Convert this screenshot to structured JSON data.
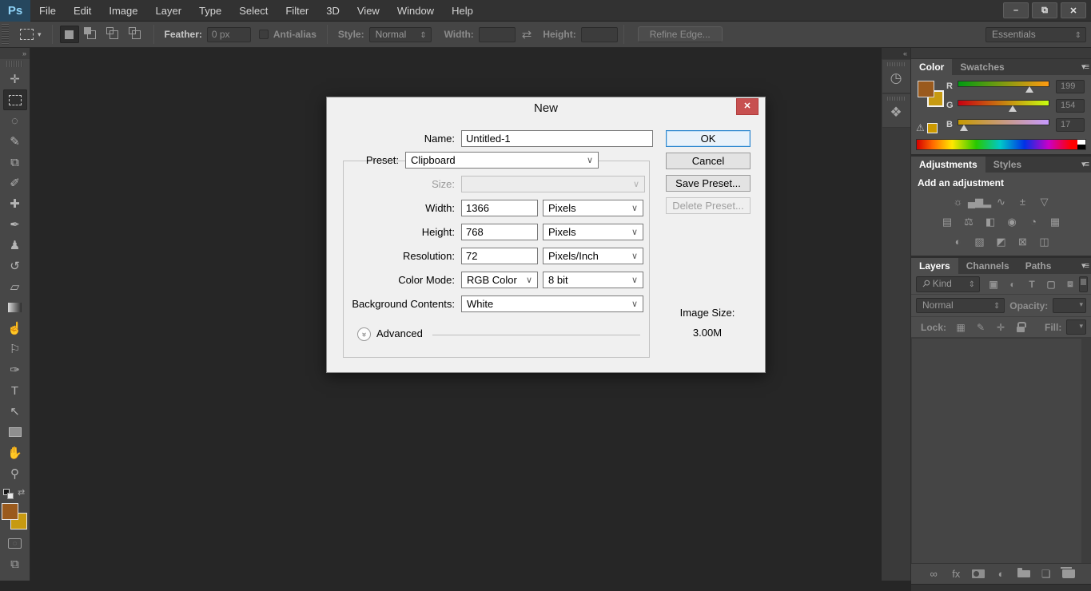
{
  "app": {
    "logo": "Ps"
  },
  "window_controls": {
    "minimize": "–",
    "restore": "⧉",
    "close": "✕"
  },
  "menu": {
    "items": [
      "File",
      "Edit",
      "Image",
      "Layer",
      "Type",
      "Select",
      "Filter",
      "3D",
      "View",
      "Window",
      "Help"
    ]
  },
  "options_bar": {
    "feather_label": "Feather:",
    "feather_value": "0 px",
    "anti_alias_label": "Anti-alias",
    "style_label": "Style:",
    "style_value": "Normal",
    "width_label": "Width:",
    "width_value": "",
    "height_label": "Height:",
    "height_value": "",
    "swap_icon": "⇄",
    "refine_edge_label": "Refine Edge...",
    "workspace": "Essentials"
  },
  "toolbar": {
    "collapse_chevron": "»",
    "foreground_color": "#9a5a1d",
    "background_color": "#c79a11",
    "tools": [
      {
        "name": "move-tool",
        "glyph": "✛"
      },
      {
        "name": "rectangular-marquee-tool",
        "glyph": "",
        "css": "icon-marquee",
        "selected": true
      },
      {
        "name": "lasso-tool",
        "glyph": "◌"
      },
      {
        "name": "quick-selection-tool",
        "glyph": "✎"
      },
      {
        "name": "crop-tool",
        "glyph": "⧉"
      },
      {
        "name": "eyedropper-tool",
        "glyph": "✐"
      },
      {
        "name": "spot-healing-brush-tool",
        "glyph": "✚"
      },
      {
        "name": "brush-tool",
        "glyph": "✒"
      },
      {
        "name": "clone-stamp-tool",
        "glyph": "♟"
      },
      {
        "name": "history-brush-tool",
        "glyph": "↺"
      },
      {
        "name": "eraser-tool",
        "glyph": "▱"
      },
      {
        "name": "gradient-tool",
        "glyph": "",
        "css": "icon-gradient"
      },
      {
        "name": "smudge-tool",
        "glyph": "☝"
      },
      {
        "name": "dodge-tool",
        "glyph": "⚐"
      },
      {
        "name": "pen-tool",
        "glyph": "✑"
      },
      {
        "name": "type-tool",
        "glyph": "T"
      },
      {
        "name": "path-selection-tool",
        "glyph": "↖"
      },
      {
        "name": "rectangle-tool",
        "glyph": "",
        "css": "icon-rectshape"
      },
      {
        "name": "hand-tool",
        "glyph": "✋"
      },
      {
        "name": "zoom-tool",
        "glyph": "⚲"
      }
    ]
  },
  "dock": {
    "collapse_chevron": "«",
    "panels": [
      {
        "name": "history-panel-button",
        "glyph": "◷"
      },
      {
        "name": "properties-panel-button",
        "glyph": "❖"
      }
    ]
  },
  "dialog": {
    "title": "New",
    "close_glyph": "✕",
    "name_label": "Name:",
    "name_value": "Untitled-1",
    "preset_label": "Preset:",
    "preset_value": "Clipboard",
    "size_label": "Size:",
    "width_label": "Width:",
    "width_value": "1366",
    "width_unit": "Pixels",
    "height_label": "Height:",
    "height_value": "768",
    "height_unit": "Pixels",
    "resolution_label": "Resolution:",
    "resolution_value": "72",
    "resolution_unit": "Pixels/Inch",
    "color_mode_label": "Color Mode:",
    "color_mode_value": "RGB Color",
    "color_depth_value": "8 bit",
    "background_label": "Background Contents:",
    "background_value": "White",
    "advanced_label": "Advanced",
    "advanced_chevron": "»",
    "image_size_label": "Image Size:",
    "image_size_value": "3.00M",
    "buttons": {
      "ok": "OK",
      "cancel": "Cancel",
      "save_preset": "Save Preset...",
      "delete_preset": "Delete Preset..."
    }
  },
  "panels": {
    "color": {
      "tabs": [
        "Color",
        "Swatches"
      ],
      "foreground_color": "#9a5a1d",
      "background_color": "#c79a11",
      "websafe_color": "#cc9900",
      "warning_glyph": "⚠",
      "r_label": "R",
      "r_value": "199",
      "g_label": "G",
      "g_value": "154",
      "b_label": "B",
      "b_value": "17"
    },
    "adjustments": {
      "tabs": [
        "Adjustments",
        "Styles"
      ],
      "heading": "Add an adjustment",
      "row1": [
        {
          "name": "brightness-contrast-icon",
          "glyph": "☼"
        },
        {
          "name": "levels-icon",
          "glyph": "▄▆▂"
        },
        {
          "name": "curves-icon",
          "glyph": "∿"
        },
        {
          "name": "exposure-icon",
          "glyph": "±"
        },
        {
          "name": "vibrance-icon",
          "glyph": "▽"
        }
      ],
      "row2": [
        {
          "name": "hue-saturation-icon",
          "glyph": "▤"
        },
        {
          "name": "color-balance-icon",
          "glyph": "⚖"
        },
        {
          "name": "black-white-icon",
          "glyph": "◧"
        },
        {
          "name": "photo-filter-icon",
          "glyph": "◉"
        },
        {
          "name": "channel-mixer-icon",
          "glyph": "◔"
        },
        {
          "name": "color-lookup-icon",
          "glyph": "▦"
        }
      ],
      "row3": [
        {
          "name": "invert-icon",
          "glyph": "◐"
        },
        {
          "name": "posterize-icon",
          "glyph": "▨"
        },
        {
          "name": "threshold-icon",
          "glyph": "◩"
        },
        {
          "name": "gradient-map-icon",
          "glyph": "⊠"
        },
        {
          "name": "selective-color-icon",
          "glyph": "◫"
        }
      ]
    },
    "layers": {
      "tabs": [
        "Layers",
        "Channels",
        "Paths"
      ],
      "kind_label": "Kind",
      "blend_mode": "Normal",
      "opacity_label": "Opacity:",
      "lock_label": "Lock:",
      "fill_label": "Fill:",
      "filter_icons": [
        {
          "name": "filter-pixel-layers-icon",
          "glyph": "▣"
        },
        {
          "name": "filter-adjustment-layers-icon",
          "glyph": "◐"
        },
        {
          "name": "filter-type-layers-icon",
          "glyph": "T"
        },
        {
          "name": "filter-shape-layers-icon",
          "glyph": "▢"
        },
        {
          "name": "filter-smart-objects-icon",
          "glyph": "⧈"
        }
      ],
      "lock_icons": [
        {
          "name": "lock-transparent-pixels-icon",
          "glyph": "▦"
        },
        {
          "name": "lock-image-pixels-icon",
          "glyph": "✎"
        },
        {
          "name": "lock-position-icon",
          "glyph": "✛"
        },
        {
          "name": "lock-all-icon",
          "glyph": "",
          "css": "icon-lock"
        }
      ],
      "bottom_icons": [
        {
          "name": "link-layers-icon",
          "glyph": "∞"
        },
        {
          "name": "layer-effects-icon",
          "glyph": "fx"
        },
        {
          "name": "add-layer-mask-icon",
          "glyph": "",
          "css": "icon-mask"
        },
        {
          "name": "adjustment-layer-icon",
          "glyph": "◐"
        },
        {
          "name": "new-group-icon",
          "glyph": "",
          "css": "icon-folder"
        },
        {
          "name": "new-layer-icon",
          "glyph": "❏"
        },
        {
          "name": "delete-layer-icon",
          "glyph": "",
          "css": "icon-trash"
        }
      ]
    }
  }
}
